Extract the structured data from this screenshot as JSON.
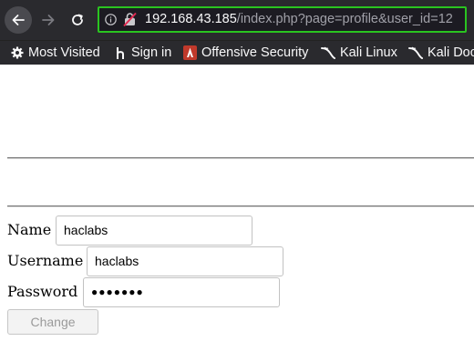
{
  "browser": {
    "url": {
      "host": "192.168.43.185",
      "path": "/index.php?page=profile&user_id=12"
    },
    "bookmarks": [
      {
        "label": "Most Visited",
        "icon": "gear-icon"
      },
      {
        "label": "Sign in",
        "icon": "hackthebox-h-icon"
      },
      {
        "label": "Offensive Security",
        "icon": "offsec-icon"
      },
      {
        "label": "Kali Linux",
        "icon": "kali-dragon-icon"
      },
      {
        "label": "Kali Doc",
        "icon": "kali-dragon-icon"
      }
    ],
    "colors": {
      "toolbar": "#2a2a2e",
      "urlbar_border": "#2ac420",
      "offsec_red": "#c0392b"
    }
  },
  "form": {
    "name_label": "Name",
    "name_value": "haclabs",
    "username_label": "Username",
    "username_value": "haclabs",
    "password_label": "Password",
    "password_dots": "●●●●●●●",
    "change_label": "Change"
  }
}
